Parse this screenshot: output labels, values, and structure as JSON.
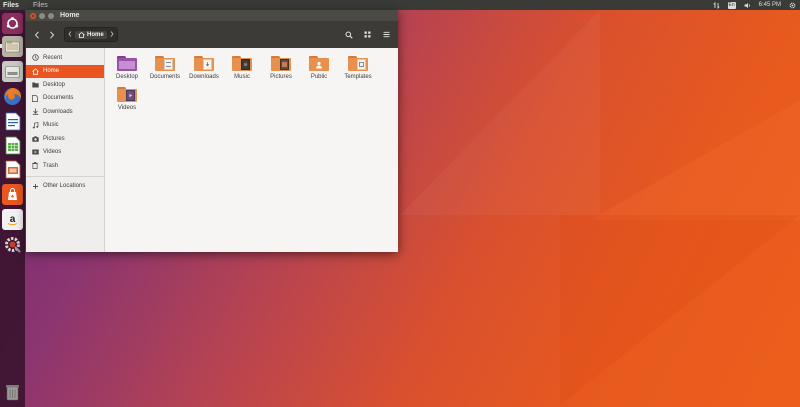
{
  "top_panel": {
    "app_name": "Files",
    "menu_files": "Files",
    "keyboard_badge": "En",
    "time": "6:45 PM"
  },
  "launcher": {
    "items": [
      {
        "icon": "ubuntu-dash-icon"
      },
      {
        "icon": "files-icon"
      },
      {
        "icon": "disk-icon"
      },
      {
        "icon": "firefox-icon"
      },
      {
        "icon": "writer-icon"
      },
      {
        "icon": "calc-icon"
      },
      {
        "icon": "impress-icon"
      },
      {
        "icon": "software-center-icon"
      },
      {
        "icon": "amazon-icon"
      },
      {
        "icon": "settings-icon"
      },
      {
        "icon": "trash-icon"
      }
    ]
  },
  "window": {
    "title": "Home",
    "path_crumb": "Home"
  },
  "sidebar": {
    "items": [
      {
        "label": "Recent",
        "icon": "clock-icon"
      },
      {
        "label": "Home",
        "icon": "home-icon",
        "active": true
      },
      {
        "label": "Desktop",
        "icon": "folder-icon"
      },
      {
        "label": "Documents",
        "icon": "document-icon"
      },
      {
        "label": "Downloads",
        "icon": "download-icon"
      },
      {
        "label": "Music",
        "icon": "music-icon"
      },
      {
        "label": "Pictures",
        "icon": "camera-icon"
      },
      {
        "label": "Videos",
        "icon": "video-icon"
      },
      {
        "label": "Trash",
        "icon": "trash-icon"
      }
    ],
    "other_locations": "Other Locations"
  },
  "files": [
    {
      "name": "Desktop"
    },
    {
      "name": "Documents"
    },
    {
      "name": "Downloads"
    },
    {
      "name": "Music"
    },
    {
      "name": "Pictures"
    },
    {
      "name": "Public"
    },
    {
      "name": "Templates"
    },
    {
      "name": "Videos"
    }
  ],
  "colors": {
    "accent": "#e95420",
    "panel": "#3a3a37",
    "headerbar": "#3c3b37",
    "folder": "#e8914e"
  }
}
